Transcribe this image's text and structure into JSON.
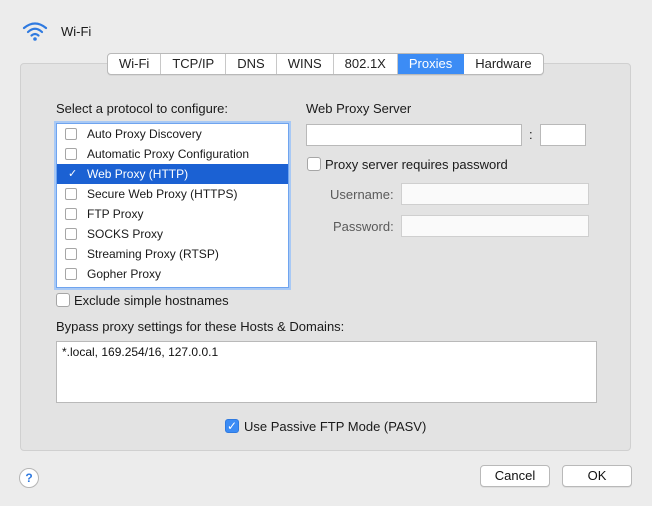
{
  "header": {
    "title": "Wi-Fi",
    "icon": "wifi-icon"
  },
  "tabs": [
    {
      "label": "Wi-Fi",
      "active": false
    },
    {
      "label": "TCP/IP",
      "active": false
    },
    {
      "label": "DNS",
      "active": false
    },
    {
      "label": "WINS",
      "active": false
    },
    {
      "label": "802.1X",
      "active": false
    },
    {
      "label": "Proxies",
      "active": true
    },
    {
      "label": "Hardware",
      "active": false
    }
  ],
  "protocols": {
    "heading": "Select a protocol to configure:",
    "items": [
      {
        "label": "Auto Proxy Discovery",
        "checked": false,
        "selected": false
      },
      {
        "label": "Automatic Proxy Configuration",
        "checked": false,
        "selected": false
      },
      {
        "label": "Web Proxy (HTTP)",
        "checked": true,
        "selected": true
      },
      {
        "label": "Secure Web Proxy (HTTPS)",
        "checked": false,
        "selected": false
      },
      {
        "label": "FTP Proxy",
        "checked": false,
        "selected": false
      },
      {
        "label": "SOCKS Proxy",
        "checked": false,
        "selected": false
      },
      {
        "label": "Streaming Proxy (RTSP)",
        "checked": false,
        "selected": false
      },
      {
        "label": "Gopher Proxy",
        "checked": false,
        "selected": false
      }
    ]
  },
  "server": {
    "heading": "Web Proxy Server",
    "host_value": "",
    "port_separator": ":",
    "port_value": "",
    "requires_password_label": "Proxy server requires password",
    "requires_password": false,
    "username_label": "Username:",
    "username_value": "",
    "password_label": "Password:",
    "password_value": ""
  },
  "exclude_simple_hostnames": {
    "label": "Exclude simple hostnames",
    "checked": false
  },
  "bypass": {
    "label": "Bypass proxy settings for these Hosts & Domains:",
    "value": "*.local, 169.254/16, 127.0.0.1"
  },
  "passive_ftp": {
    "label": "Use Passive FTP Mode (PASV)",
    "checked": true
  },
  "buttons": {
    "help": "?",
    "cancel": "Cancel",
    "ok": "OK"
  },
  "colors": {
    "accent": "#3c8cf5",
    "selection": "#1b61d3"
  }
}
